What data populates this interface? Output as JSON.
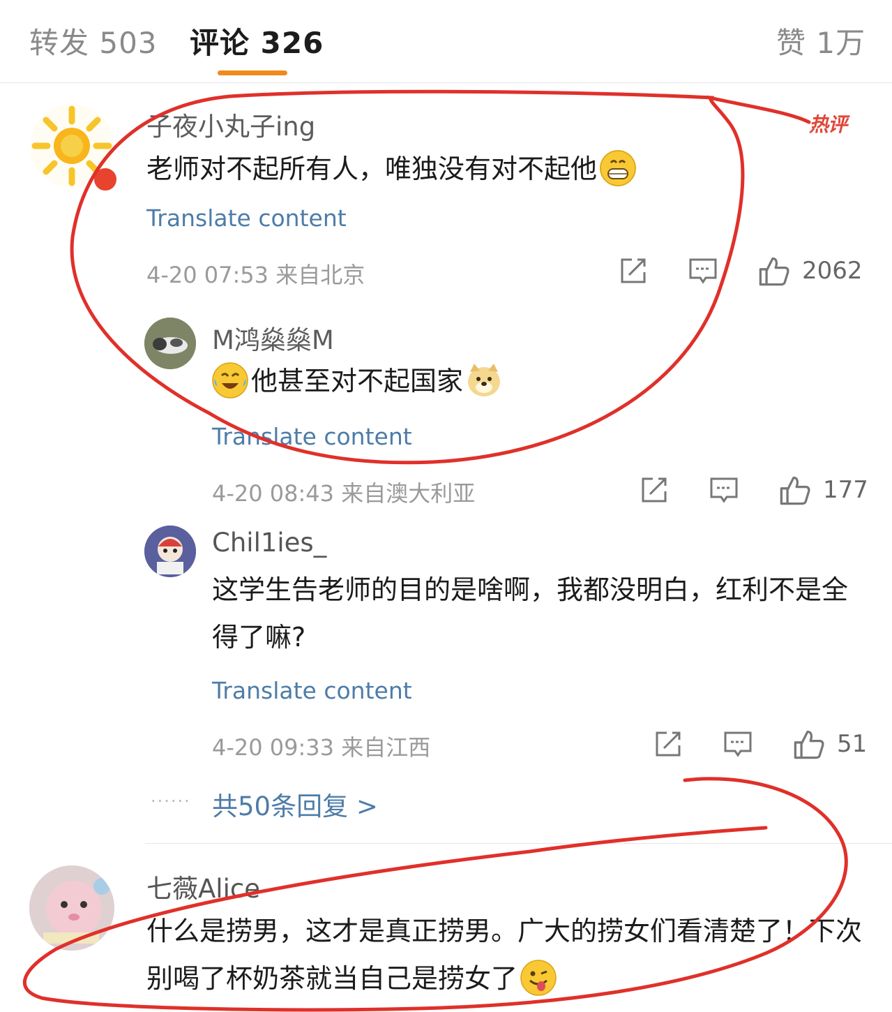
{
  "tabs": {
    "forward": "转发 503",
    "comments": "评论 326",
    "likes": "赞 1万"
  },
  "hot_badge": "热评",
  "comments": [
    {
      "user": "子夜小丸子ing",
      "text": "老师对不起所有人，唯独没有对不起他",
      "emoji": "grin-emoji",
      "translate": "Translate content",
      "time": "4-20 07:53 来自北京",
      "likes": "2062"
    },
    {
      "user": "M鸿燊燊M",
      "text": "他甚至对不起国家",
      "emoji_before": "laugh-cry-emoji",
      "emoji_after": "doge-emoji",
      "translate": "Translate content",
      "time": "4-20 08:43 来自澳大利亚",
      "likes": "177"
    },
    {
      "user": "Chil1ies_",
      "text": "这学生告老师的目的是啥啊，我都没明白，红利不是全得了嘛?",
      "translate": "Translate content",
      "time": "4-20 09:33 来自江西",
      "likes": "51"
    },
    {
      "user": "七薇Alice",
      "text": "什么是捞男，这才是真正捞男。广大的捞女们看清楚了！下次别喝了杯奶茶就当自己是捞女了",
      "emoji": "tongue-emoji"
    }
  ],
  "more_replies": "共50条回复 >",
  "more_dots": "······",
  "colors": {
    "accent": "#f08a1c",
    "link": "#4d7ca8",
    "annotation": "#e0302a",
    "hot": "#e0473a"
  }
}
